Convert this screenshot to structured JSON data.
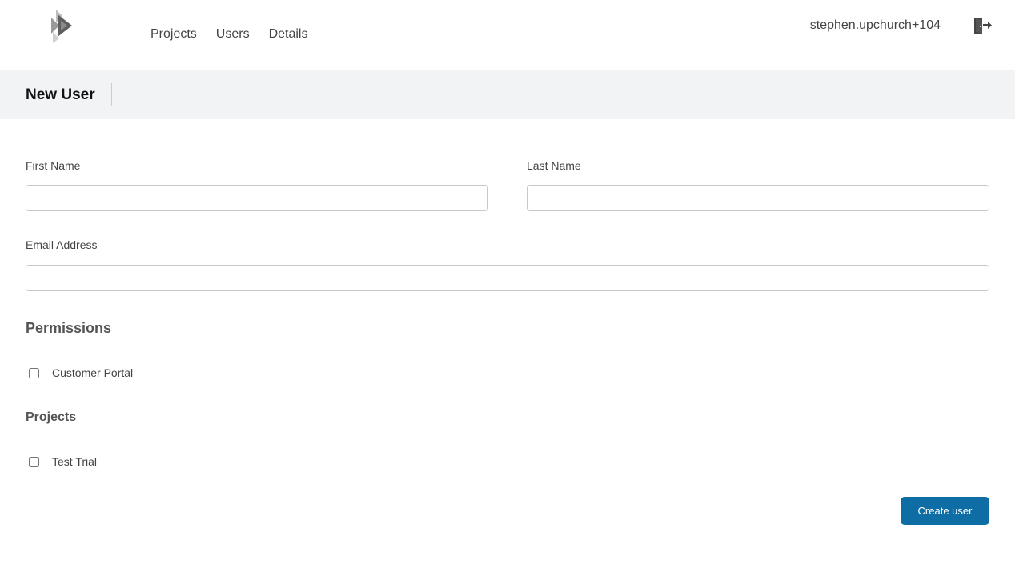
{
  "nav": {
    "items": [
      "Projects",
      "Users",
      "Details"
    ]
  },
  "user": {
    "name": "stephen.upchurch+104"
  },
  "page": {
    "title": "New User"
  },
  "form": {
    "first_name": {
      "label": "First Name",
      "value": "",
      "placeholder": ""
    },
    "last_name": {
      "label": "Last Name",
      "value": "",
      "placeholder": ""
    },
    "email": {
      "label": "Email Address",
      "value": "",
      "placeholder": ""
    },
    "permissions": {
      "title": "Permissions",
      "options": [
        {
          "label": "Customer Portal",
          "checked": false
        }
      ]
    },
    "projects": {
      "title": "Projects",
      "options": [
        {
          "label": "Test Trial",
          "checked": false
        }
      ]
    },
    "submit_label": "Create user"
  },
  "colors": {
    "accent": "#0f6da6",
    "header_bg": "#f2f3f5"
  },
  "icons": {
    "logo": "diamond-logo-icon",
    "logout": "logout-door-icon"
  }
}
